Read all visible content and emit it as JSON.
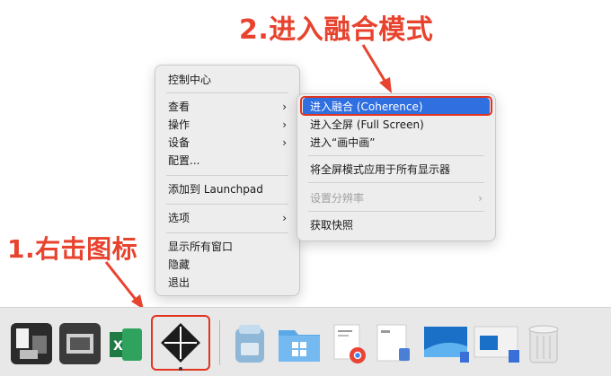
{
  "annotations": {
    "step2": "2.进入融合模式",
    "step1": "1.右击图标"
  },
  "context_menu": {
    "items": [
      {
        "label": "控制中心"
      },
      {
        "label": "查看",
        "submenu": true
      },
      {
        "label": "操作",
        "submenu": true
      },
      {
        "label": "设备",
        "submenu": true
      },
      {
        "label": "配置..."
      },
      {
        "label": "添加到 Launchpad"
      },
      {
        "label": "选项",
        "submenu": true
      },
      {
        "label": "显示所有窗口"
      },
      {
        "label": "隐藏"
      },
      {
        "label": "退出"
      }
    ]
  },
  "submenu": {
    "items": [
      {
        "label": "进入融合 (Coherence)",
        "highlighted": true
      },
      {
        "label": "进入全屏 (Full Screen)"
      },
      {
        "label": "进入“画中画”"
      },
      {
        "label": "将全屏模式应用于所有显示器"
      },
      {
        "label": "设置分辨率",
        "disabled": true,
        "submenu": true
      },
      {
        "label": "获取快照"
      }
    ]
  },
  "chevron": "›",
  "colors": {
    "annotation_red": "#e8432e",
    "highlight_blue": "#2f6fe0"
  },
  "dock": {
    "icons": [
      "windows-app-icon",
      "windows-app-icon",
      "excel-icon",
      "parallels-icon",
      "disk-utility-icon",
      "windows-folder-icon",
      "chrome-document-icon",
      "document-icon",
      "windows-desktop-icon",
      "windows-desktop-icon",
      "trash-icon"
    ]
  }
}
